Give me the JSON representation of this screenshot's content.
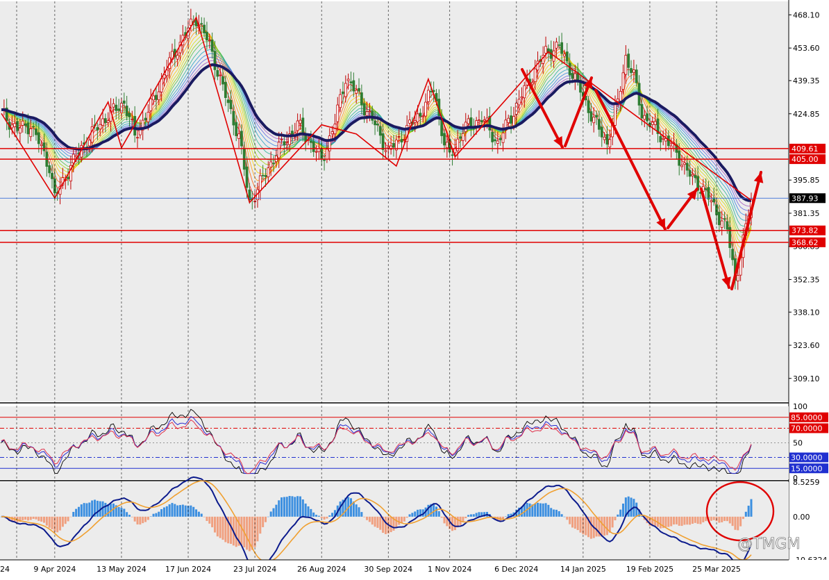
{
  "colors": {
    "background": "#ececec",
    "axis_panel": "#ffffff",
    "bull_candle": "#c00000",
    "bear_candle": "#2e7d32",
    "slow_ma": "#1a1a60",
    "level_line": "#e00000",
    "current_price_line": "#3a6fd8",
    "rsi_fast": "#000000",
    "rsi_mid": "#2b2bd0",
    "rsi_slow": "#e0304a",
    "macd_line": "#0b1a8c",
    "macd_signal": "#f0a030",
    "hist_pos": "#3c8fe0",
    "hist_neg": "#f0a080",
    "annotation": "#e00000"
  },
  "watermark": "@TMGM",
  "price_panel": {
    "ylim": [
      299.0,
      474.0
    ],
    "ticks": [
      "468.10",
      "453.60",
      "439.35",
      "424.85",
      "395.85",
      "381.35",
      "366.85",
      "352.35",
      "338.10",
      "323.60",
      "309.10"
    ],
    "levels": [
      {
        "value": 409.61,
        "label": "409.61"
      },
      {
        "value": 405.0,
        "label": "405.00"
      },
      {
        "value": 373.82,
        "label": "373.82"
      },
      {
        "value": 368.62,
        "label": "368.62"
      }
    ],
    "current_price": {
      "value": 387.93,
      "label": "387.93"
    }
  },
  "rsi_panel": {
    "ylim": [
      0,
      100
    ],
    "top_tick": "100",
    "mid_tick": "50",
    "bottom_tick": "0",
    "levels": [
      {
        "value": 85,
        "label": "85.0000"
      },
      {
        "value": 70,
        "label": "70.0000"
      },
      {
        "value": 30,
        "label": "30.0000"
      },
      {
        "value": 15,
        "label": "15.0000"
      }
    ]
  },
  "macd_panel": {
    "ylim": [
      -10.6324,
      8.5259
    ],
    "ticks": [
      "8.5259",
      "0.00",
      "-10.6324"
    ]
  },
  "chart_data": {
    "type": "candlestick",
    "x_labels": [
      "24",
      "9 Apr 2024",
      "13 May 2024",
      "17 Jun 2024",
      "23 Jul 2024",
      "26 Aug 2024",
      "30 Sep 2024",
      "1 Nov 2024",
      "6 Dec 2024",
      "14 Jan 2025",
      "19 Feb 2025",
      "25 Mar 2025"
    ],
    "approx_close_path": [
      [
        0,
        425
      ],
      [
        6,
        418
      ],
      [
        11,
        420
      ],
      [
        18,
        402
      ],
      [
        20,
        388
      ],
      [
        25,
        400
      ],
      [
        30,
        410
      ],
      [
        38,
        422
      ],
      [
        46,
        430
      ],
      [
        50,
        415
      ],
      [
        56,
        428
      ],
      [
        62,
        445
      ],
      [
        68,
        458
      ],
      [
        73,
        467
      ],
      [
        78,
        455
      ],
      [
        83,
        436
      ],
      [
        89,
        415
      ],
      [
        93,
        386
      ],
      [
        96,
        392
      ],
      [
        103,
        408
      ],
      [
        111,
        420
      ],
      [
        116,
        412
      ],
      [
        120,
        404
      ],
      [
        125,
        421
      ],
      [
        129,
        441
      ],
      [
        134,
        432
      ],
      [
        140,
        420
      ],
      [
        145,
        408
      ],
      [
        152,
        418
      ],
      [
        157,
        425
      ],
      [
        162,
        436
      ],
      [
        166,
        412
      ],
      [
        168,
        406
      ],
      [
        173,
        418
      ],
      [
        180,
        423
      ],
      [
        186,
        412
      ],
      [
        192,
        426
      ],
      [
        198,
        440
      ],
      [
        204,
        452
      ],
      [
        209,
        454
      ],
      [
        213,
        445
      ],
      [
        217,
        435
      ],
      [
        222,
        422
      ],
      [
        227,
        412
      ],
      [
        231,
        430
      ],
      [
        234,
        450
      ],
      [
        237,
        441
      ],
      [
        240,
        425
      ],
      [
        245,
        418
      ],
      [
        250,
        412
      ],
      [
        255,
        404
      ],
      [
        259,
        396
      ],
      [
        263,
        392
      ],
      [
        268,
        382
      ],
      [
        272,
        374
      ],
      [
        275,
        352
      ],
      [
        278,
        369
      ],
      [
        281,
        387
      ]
    ],
    "annotations": [
      {
        "type": "zigzag",
        "color": "#e00000"
      },
      {
        "type": "arrow",
        "direction": "down",
        "color": "#e00000"
      },
      {
        "type": "arrow",
        "direction": "up",
        "color": "#e00000"
      },
      {
        "type": "arrow",
        "direction": "down",
        "color": "#e00000"
      },
      {
        "type": "arrow",
        "direction": "up",
        "color": "#e00000"
      },
      {
        "type": "arrow",
        "direction": "down",
        "color": "#e00000"
      },
      {
        "type": "arrow",
        "direction": "up",
        "color": "#e00000"
      },
      {
        "type": "circle",
        "color": "#e00000"
      }
    ],
    "grid": true
  }
}
